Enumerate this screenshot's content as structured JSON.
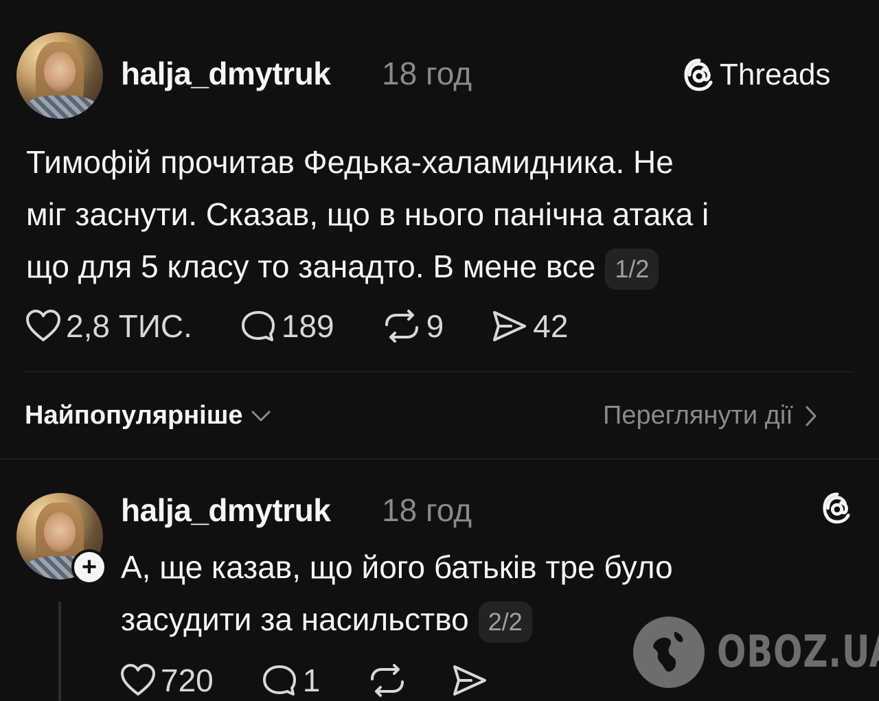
{
  "post": {
    "username": "halja_dmytruk",
    "time": "18 год",
    "brand": "Threads",
    "text_lines": [
      "Тимофій прочитав Федька-халамидника. Не",
      "міг заснути. Сказав, що в нього панічна атака і",
      "що для 5 класу то занадто. В мене все"
    ],
    "page_badge": "1/2",
    "likes": "2,8 ТИС.",
    "comments": "189",
    "reposts": "9",
    "shares": "42"
  },
  "sort": {
    "label": "Найпопулярніше",
    "view_activity": "Переглянути дії"
  },
  "reply": {
    "username": "halja_dmytruk",
    "time": "18 год",
    "text_lines": [
      "А, ще казав, що його батьків тре було",
      "засудити за насильство"
    ],
    "page_badge": "2/2",
    "likes": "720",
    "comments": "1"
  },
  "watermark": {
    "text": "OBOZ.UA"
  },
  "colors": {
    "background": "#101010",
    "text": "#f3f5f7",
    "muted": "#8a8a8a"
  }
}
